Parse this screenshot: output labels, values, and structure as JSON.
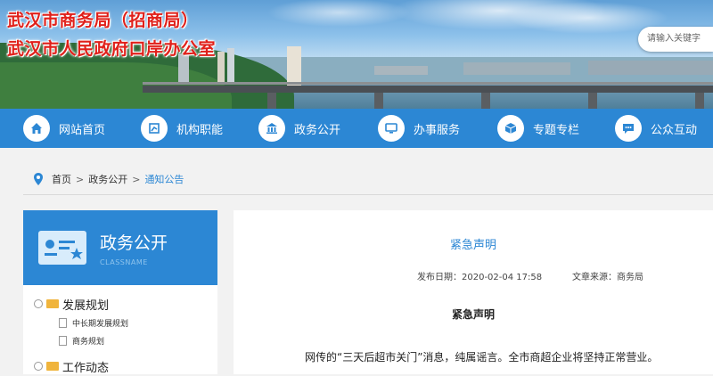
{
  "header": {
    "title_line1": "武汉市商务局（招商局）",
    "title_line2": "武汉市人民政府口岸办公室",
    "search_placeholder": "请输入关键字"
  },
  "nav": {
    "items": [
      {
        "label": "网站首页",
        "icon": "home-icon"
      },
      {
        "label": "机构职能",
        "icon": "chart-icon"
      },
      {
        "label": "政务公开",
        "icon": "building-icon"
      },
      {
        "label": "办事服务",
        "icon": "monitor-icon"
      },
      {
        "label": "专题专栏",
        "icon": "cube-icon"
      },
      {
        "label": "公众互动",
        "icon": "chat-icon"
      }
    ]
  },
  "breadcrumb": {
    "items": [
      "首页",
      "政务公开",
      "通知公告"
    ],
    "separator": ">"
  },
  "sidebar": {
    "title": "政务公开",
    "subtitle": "CLASSNAME",
    "categories": [
      {
        "label": "发展规划",
        "children": [
          "中长期发展规划",
          "商务规划"
        ]
      },
      {
        "label": "工作动态",
        "children": []
      }
    ]
  },
  "article": {
    "title": "紧急声明",
    "publish_label": "发布日期：",
    "publish_date": "2020-02-04 17:58",
    "source_label": "文章来源：",
    "source": "商务局",
    "body_title": "紧急声明",
    "paragraph": "网传的“三天后超市关门”消息，纯属谣言。全市商超企业将坚持正常营业。"
  },
  "colors": {
    "brand_blue": "#2c87d4",
    "title_red": "#e0201a"
  }
}
